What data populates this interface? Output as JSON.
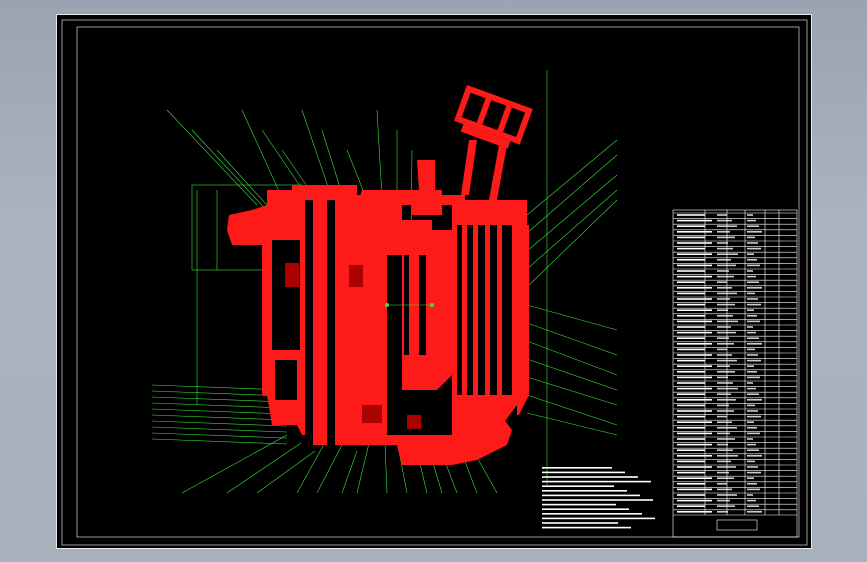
{
  "drawing": {
    "view": "cad-model-space",
    "colors": {
      "background": "#000000",
      "part_fill": "#ff1a1a",
      "leader": "#39e639",
      "frame": "#ffffff",
      "window_bg": "#9aa3b1"
    },
    "icons": [
      "cad-frame-icon",
      "assembly-section-icon",
      "title-block-icon"
    ]
  }
}
